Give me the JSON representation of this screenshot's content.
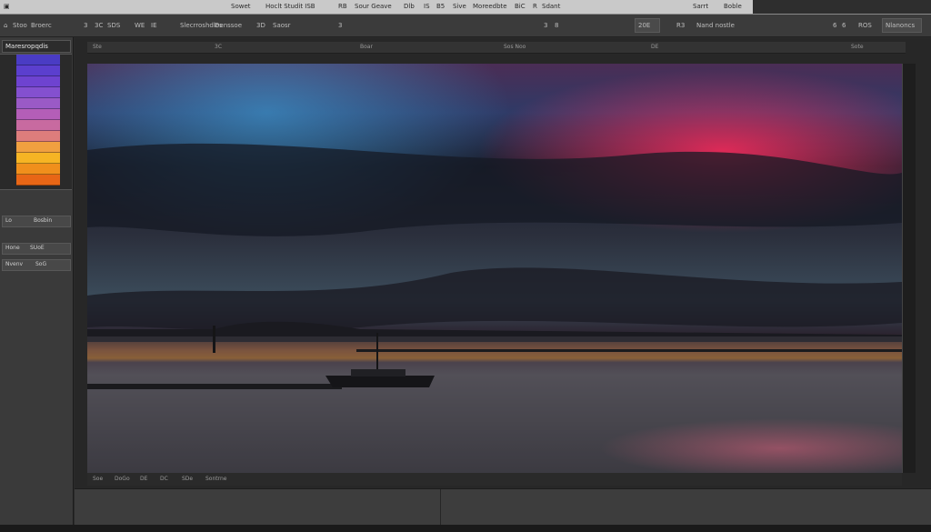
{
  "menubar": {
    "items": [
      "Sowet",
      "Hoclt Studit ISB",
      "RB",
      "Sour Geave",
      "Dlb",
      "IS",
      "B5",
      "Sive",
      "Moreedbte",
      "BiC",
      "R",
      "Sdant"
    ],
    "right": [
      "Sarrt",
      "Boble"
    ]
  },
  "toolbar": {
    "items": [
      "Stoo",
      "Broerc",
      "3",
      "3C",
      "SDS",
      "WE",
      "IE",
      "Slecrroshdles",
      "Denssoe",
      "3D",
      "Saosr",
      "3",
      "3",
      "8",
      "20E",
      "R3",
      "Nand nostle",
      "6",
      "6",
      "ROS",
      "Nlanoncs"
    ]
  },
  "left_panel": {
    "tab_label": "Maresropqdis",
    "swatch_colors": [
      "#4a3cc4",
      "#5b3fce",
      "#6e43d0",
      "#8450cf",
      "#9a5ac6",
      "#b45eb8",
      "#c86aa0",
      "#dd7d7c",
      "#f0a040",
      "#f6b424",
      "#f08f1c",
      "#e86616"
    ],
    "rows": [
      {
        "left": "Lo",
        "right": "Bosbin"
      },
      {
        "left": "Hone",
        "right": "SUoE"
      },
      {
        "left": "Nvenv",
        "right": "SoG"
      }
    ]
  },
  "canvas": {
    "ruler_labels": [
      "Ste",
      "3C",
      "Boar",
      "Sos Noo",
      "DE",
      "Sote"
    ],
    "status_items": [
      "Soe",
      "DoGo",
      "DE",
      "DC",
      "SDe",
      "Sontrne"
    ]
  }
}
